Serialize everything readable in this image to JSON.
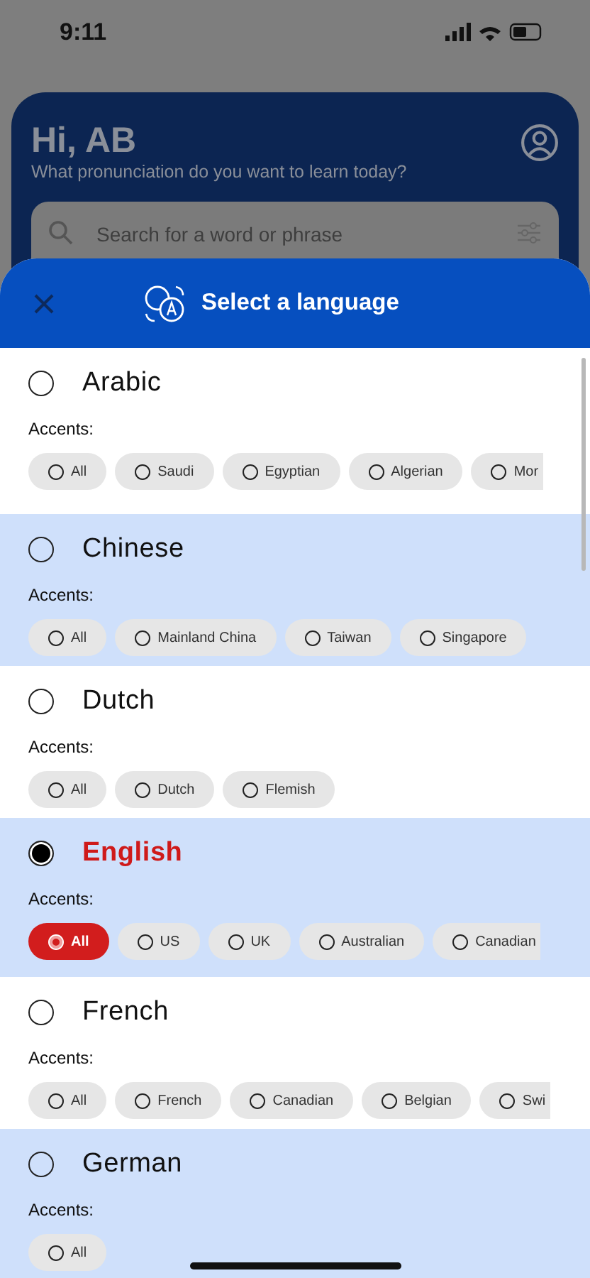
{
  "status_bar": {
    "time": "9:11"
  },
  "home": {
    "greeting": "Hi, AB",
    "subtitle": "What pronunciation do you want to learn today?",
    "search": {
      "placeholder": "Search for a word or phrase"
    }
  },
  "sheet": {
    "title": "Select a language",
    "languages": [
      {
        "name": "Arabic",
        "selected": false,
        "accents_label": "Accents:",
        "accents": [
          {
            "label": "All",
            "selected": false
          },
          {
            "label": "Saudi",
            "selected": false
          },
          {
            "label": "Egyptian",
            "selected": false
          },
          {
            "label": "Algerian",
            "selected": false
          },
          {
            "label": "Mor",
            "selected": false
          }
        ]
      },
      {
        "name": "Chinese",
        "selected": false,
        "accents_label": "Accents:",
        "accents": [
          {
            "label": "All",
            "selected": false
          },
          {
            "label": "Mainland China",
            "selected": false
          },
          {
            "label": "Taiwan",
            "selected": false
          },
          {
            "label": "Singapore",
            "selected": false
          }
        ]
      },
      {
        "name": "Dutch",
        "selected": false,
        "accents_label": "Accents:",
        "accents": [
          {
            "label": "All",
            "selected": false
          },
          {
            "label": "Dutch",
            "selected": false
          },
          {
            "label": "Flemish",
            "selected": false
          }
        ]
      },
      {
        "name": "English",
        "selected": true,
        "accents_label": "Accents:",
        "accents": [
          {
            "label": "All",
            "selected": true
          },
          {
            "label": "US",
            "selected": false
          },
          {
            "label": "UK",
            "selected": false
          },
          {
            "label": "Australian",
            "selected": false
          },
          {
            "label": "Canadian",
            "selected": false
          }
        ]
      },
      {
        "name": "French",
        "selected": false,
        "accents_label": "Accents:",
        "accents": [
          {
            "label": "All",
            "selected": false
          },
          {
            "label": "French",
            "selected": false
          },
          {
            "label": "Canadian",
            "selected": false
          },
          {
            "label": "Belgian",
            "selected": false
          },
          {
            "label": "Swi",
            "selected": false
          }
        ]
      },
      {
        "name": "German",
        "selected": false,
        "accents_label": "Accents:",
        "accents": [
          {
            "label": "All",
            "selected": false
          }
        ]
      }
    ]
  }
}
